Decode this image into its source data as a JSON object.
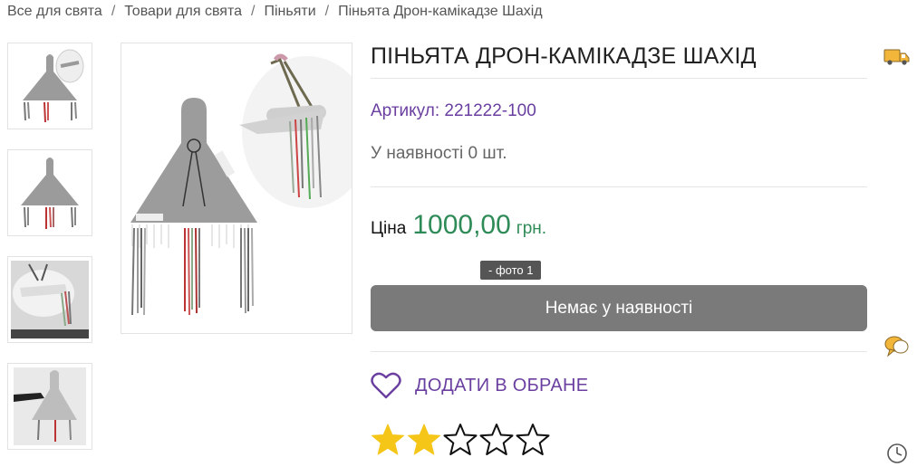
{
  "breadcrumb": [
    "Все для свята",
    "Товари для свята",
    "Піньяти",
    "Піньята Дрон-камікадзе Шахід"
  ],
  "breadcrumb_separator": "/",
  "product": {
    "title": "ПІНЬЯТА ДРОН-КАМІКАДЗЕ ШАХІД",
    "sku": "Артикул: 221222-100",
    "stock": "У наявності 0 шт.",
    "price_label": "Ціна",
    "price_value": "1000,00",
    "price_currency": "грн.",
    "tooltip": "- фото 1",
    "buy_button": "Немає у наявності",
    "favorite_label": "ДОДАТИ В ОБРАНЕ",
    "rating": 2,
    "rating_max": 5
  },
  "thumbnails": [
    "thumb-1",
    "thumb-2",
    "thumb-3",
    "thumb-4"
  ],
  "side_icons": [
    "delivery-truck-icon",
    "chat-bubble-icon",
    "clock-icon"
  ],
  "colors": {
    "accent": "#6a3fa0",
    "price": "#2e8b57",
    "star": "#f5c518",
    "button": "#7a7a7a"
  }
}
